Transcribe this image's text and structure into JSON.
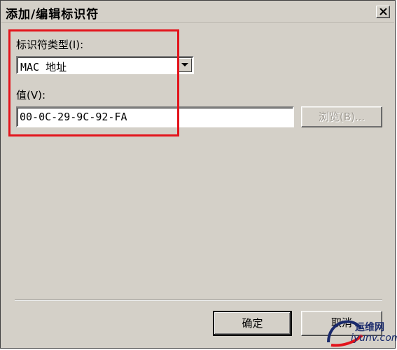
{
  "window": {
    "title": "添加/编辑标识符",
    "close_glyph": "✕"
  },
  "identifier_type": {
    "label": "标识符类型(I):",
    "selected_value": "MAC 地址"
  },
  "value_field": {
    "label": "值(V):",
    "value": "00-0C-29-9C-92-FA"
  },
  "buttons": {
    "browse_label": "浏览(B)...",
    "browse_enabled": false,
    "ok_label": "确定",
    "cancel_label": "取消"
  },
  "annotation": {
    "highlight_color": "#e3141c"
  },
  "watermark": {
    "line1": "运维网",
    "line2": "iyunv.com"
  }
}
